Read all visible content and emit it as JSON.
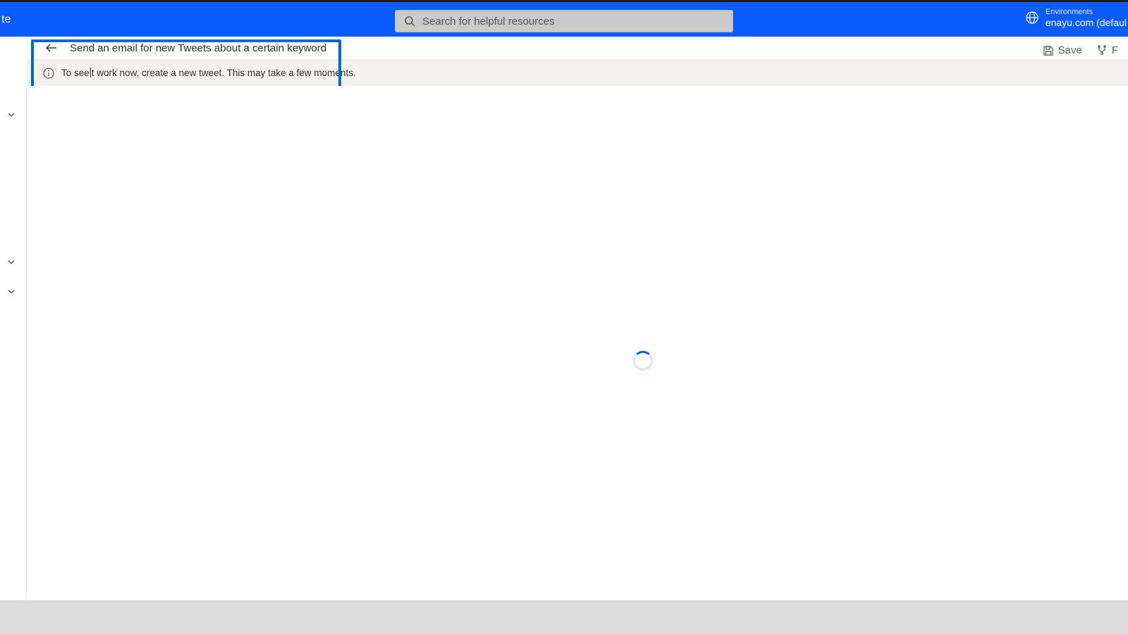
{
  "header": {
    "brand_fragment": "te",
    "search_placeholder": "Search for helpful resources",
    "env_label": "Environments",
    "env_name": "enayu.com (defaul"
  },
  "titlebar": {
    "title": "Send an email for new Tweets about a certain keyword"
  },
  "actions": {
    "save": "Save",
    "flowchecker_fragment": "F"
  },
  "info": {
    "text_before": "To see",
    "text_after": "t work now, create a new tweet. This may take a few moments."
  }
}
